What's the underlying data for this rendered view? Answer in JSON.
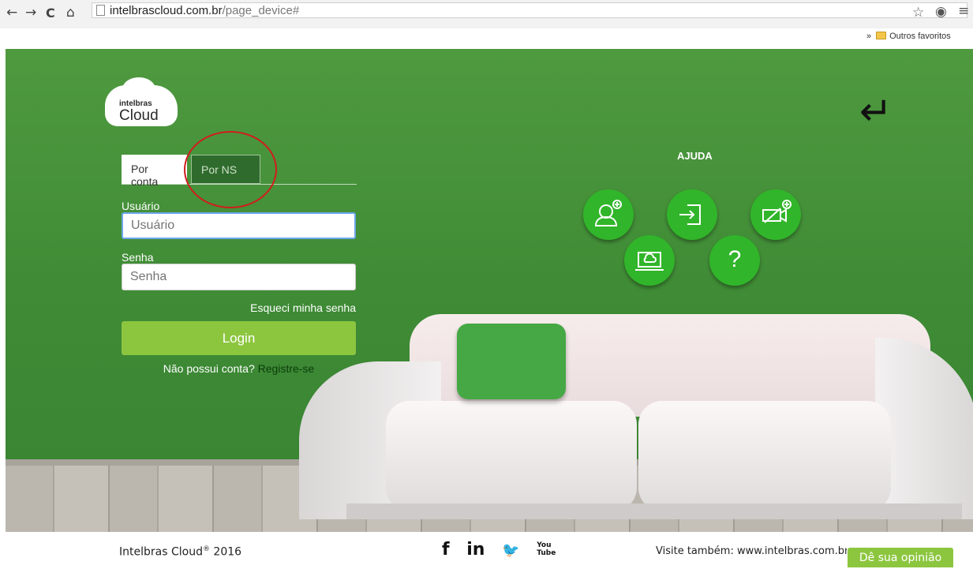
{
  "browser": {
    "url_host": "intelbrascloud.com.br",
    "url_path": "/page_device#",
    "nav": {
      "back": "←",
      "forward": "→",
      "reload": "C",
      "home": "⌂"
    },
    "bookmarks": {
      "chevron": "»",
      "folder_label": "Outros favoritos"
    }
  },
  "logo": {
    "brand": "intelbras",
    "product": "Cloud"
  },
  "login": {
    "tab_account": "Por conta",
    "tab_ns": "Por NS",
    "user_label": "Usuário",
    "user_placeholder": "Usuário",
    "pass_label": "Senha",
    "pass_placeholder": "Senha",
    "forgot": "Esqueci minha senha",
    "login_button": "Login",
    "no_account": "Não possui conta?",
    "register": "Registre-se"
  },
  "help": {
    "title": "AJUDA",
    "icons": [
      "add-user-icon",
      "login-icon",
      "add-camera-icon",
      "cloud-device-icon",
      "question-icon"
    ],
    "question_glyph": "?"
  },
  "back_arrow": "↵",
  "footer": {
    "copyright": "Intelbras Cloud",
    "registered": "®",
    "year": "2016",
    "social": {
      "facebook": "f",
      "linkedin": "in",
      "twitter": "🐦",
      "youtube": "You Tube"
    },
    "visit": "Visite também: www.intelbras.com.br",
    "feedback": "Dê sua opinião"
  },
  "colors": {
    "accent": "#8cc63f",
    "wall": "#3e8a35",
    "help_circle": "#31b52a",
    "annotation": "#d11c1c"
  }
}
